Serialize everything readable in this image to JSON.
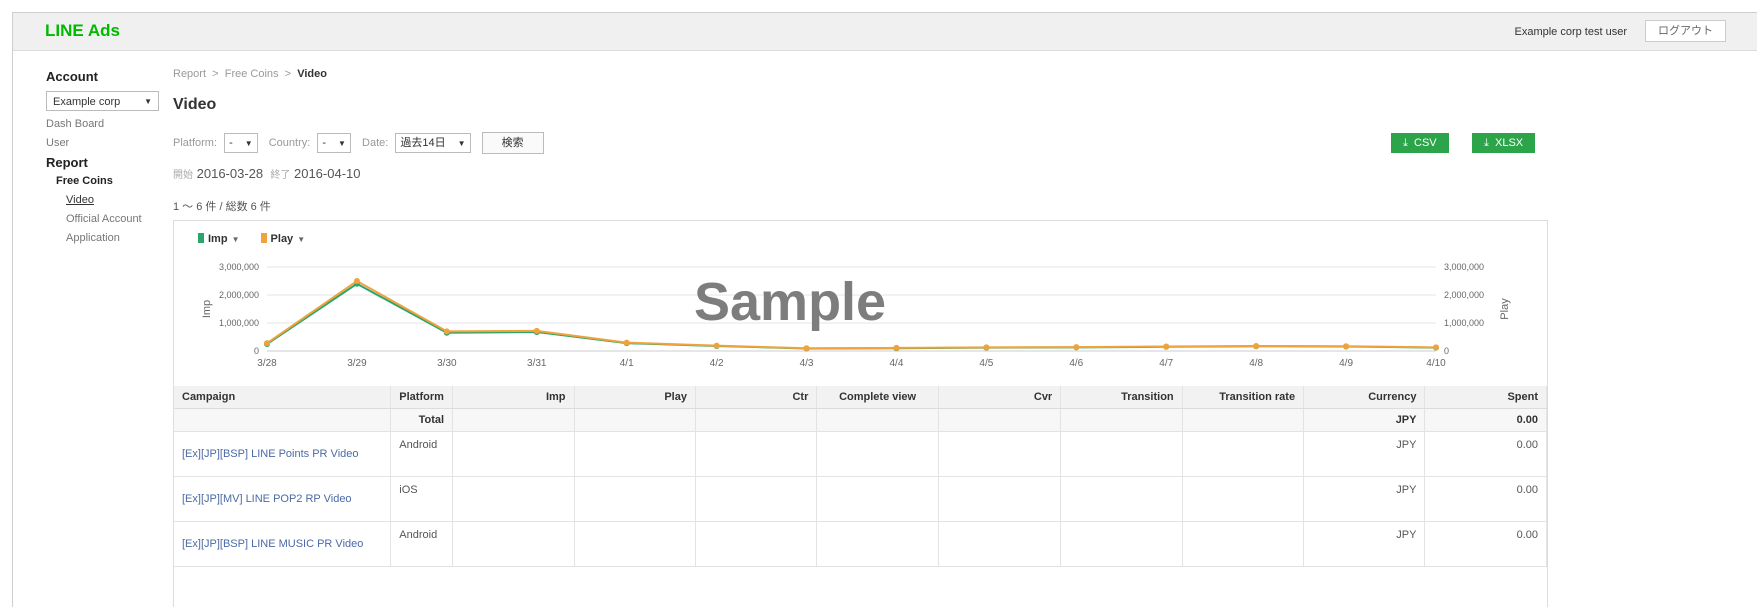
{
  "header": {
    "logo": "LINE Ads",
    "user": "Example corp test user",
    "logout": "ログアウト"
  },
  "sidebar": {
    "account_heading": "Account",
    "account_select": "Example corp",
    "items": [
      "Dash Board",
      "User"
    ],
    "report_heading": "Report",
    "free_coins": "Free Coins",
    "sub_items": [
      "Video",
      "Official Account",
      "Application"
    ],
    "active_sub": "Video"
  },
  "breadcrumb": {
    "items": [
      "Report",
      "Free Coins"
    ],
    "sep": ">",
    "current": "Video"
  },
  "page_title": "Video",
  "filters": {
    "platform_label": "Platform:",
    "platform_value": "-",
    "country_label": "Country:",
    "country_value": "-",
    "date_label": "Date:",
    "date_value": "過去14日",
    "search": "検索"
  },
  "downloads": {
    "csv": "CSV",
    "xlsx": "XLSX",
    "icon": "download-icon"
  },
  "dates": {
    "start_label": "開始",
    "start": "2016-03-28",
    "end_label": "終了",
    "end": "2016-04-10"
  },
  "count": "1 ～ 6 件 / 総数 6 件",
  "colors": {
    "brand": "#00b900",
    "button": "#2ca44a",
    "imp": "#2ca56b",
    "play": "#f0a33c"
  },
  "watermark": "Sample",
  "chart_data": {
    "type": "line",
    "legend": [
      "Imp",
      "Play"
    ],
    "x": [
      "3/28",
      "3/29",
      "3/30",
      "3/31",
      "4/1",
      "4/2",
      "4/3",
      "4/4",
      "4/5",
      "4/6",
      "4/7",
      "4/8",
      "4/9",
      "4/10"
    ],
    "series": [
      {
        "name": "Imp",
        "values": [
          250000,
          2400000,
          650000,
          680000,
          280000,
          180000,
          90000,
          100000,
          120000,
          130000,
          150000,
          170000,
          160000,
          120000
        ]
      },
      {
        "name": "Play",
        "values": [
          280000,
          2500000,
          700000,
          720000,
          300000,
          190000,
          100000,
          110000,
          130000,
          140000,
          160000,
          180000,
          170000,
          130000
        ]
      }
    ],
    "ylabel_left": "Imp",
    "ylabel_right": "Play",
    "y_ticks": [
      "0",
      "1,000,000",
      "2,000,000",
      "3,000,000"
    ],
    "ylim": [
      0,
      3000000
    ],
    "grid": true
  },
  "table": {
    "headers": [
      "Campaign",
      "Platform",
      "Imp",
      "Play",
      "Ctr",
      "Complete view",
      "Cvr",
      "Transition",
      "Transition rate",
      "Currency",
      "Spent"
    ],
    "total": {
      "label": "Total",
      "currency": "JPY",
      "spent": "0.00"
    },
    "rows": [
      {
        "campaign": "[Ex][JP][BSP] LINE Points PR Video",
        "platform": "Android",
        "currency": "JPY",
        "spent": "0.00"
      },
      {
        "campaign": "[Ex][JP][MV] LINE POP2 RP Video",
        "platform": "iOS",
        "currency": "JPY",
        "spent": "0.00"
      },
      {
        "campaign": "[Ex][JP][BSP] LINE MUSIC PR Video",
        "platform": "Android",
        "currency": "JPY",
        "spent": "0.00"
      }
    ]
  }
}
